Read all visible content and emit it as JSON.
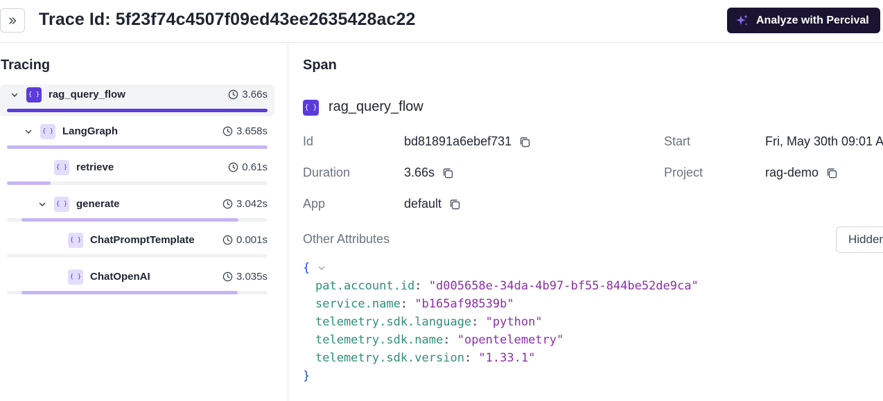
{
  "header": {
    "title": "Trace Id: 5f23f74c4507f09ed43ee2635428ac22",
    "analyze_label": "Analyze with Percival"
  },
  "tracing": {
    "title": "Tracing",
    "spans": [
      {
        "name": "rag_query_flow",
        "duration": "3.66s",
        "depth": 0,
        "expanded": true,
        "selected": true,
        "bar_start": 0.0,
        "bar_fraction": 1.0
      },
      {
        "name": "LangGraph",
        "duration": "3.658s",
        "depth": 1,
        "expanded": true,
        "selected": false,
        "bar_start": 0.0,
        "bar_fraction": 1.0
      },
      {
        "name": "retrieve",
        "duration": "0.61s",
        "depth": 2,
        "expanded": false,
        "selected": false,
        "bar_start": 0.0,
        "bar_fraction": 0.167
      },
      {
        "name": "generate",
        "duration": "3.042s",
        "depth": 2,
        "expanded": true,
        "selected": false,
        "bar_start": 0.0554,
        "bar_fraction": 0.8316
      },
      {
        "name": "ChatPromptTemplate",
        "duration": "0.001s",
        "depth": 3,
        "expanded": false,
        "selected": false,
        "bar_start": 0.0,
        "bar_fraction": 0.0
      },
      {
        "name": "ChatOpenAI",
        "duration": "3.035s",
        "depth": 3,
        "expanded": false,
        "selected": false,
        "bar_start": 0.0554,
        "bar_fraction": 0.8292
      }
    ]
  },
  "span": {
    "title": "Span",
    "name": "rag_query_flow",
    "id_label": "Id",
    "id_value": "bd81891a6ebef731",
    "duration_label": "Duration",
    "duration_value": "3.66s",
    "app_label": "App",
    "app_value": "default",
    "start_label": "Start",
    "start_value": "Fri, May 30th 09:01 A",
    "project_label": "Project",
    "project_value": "rag-demo",
    "other_attributes_label": "Other Attributes",
    "hidden_button_label": "Hidden"
  },
  "attributes_json": {
    "open_brace": "{",
    "close_brace": "}",
    "entries": [
      {
        "key": "pat.account.id",
        "value": "\"d005658e-34da-4b97-bf55-844be52de9ca\""
      },
      {
        "key": "service.name",
        "value": "\"b165af98539b\""
      },
      {
        "key": "telemetry.sdk.language",
        "value": "\"python\""
      },
      {
        "key": "telemetry.sdk.name",
        "value": "\"opentelemetry\""
      },
      {
        "key": "telemetry.sdk.version",
        "value": "\"1.33.1\""
      }
    ]
  },
  "colors": {
    "accent": "#5b3bdb",
    "accent_light": "#c4b5f5",
    "analyze_bg": "#1a1430"
  },
  "icons": {
    "expand": "chevrons-right-icon",
    "analyze": "sparkle-icon",
    "span": "braces-icon",
    "duration": "clock-icon",
    "copy": "copy-icon",
    "tree_toggle": "chevron-down-icon"
  }
}
